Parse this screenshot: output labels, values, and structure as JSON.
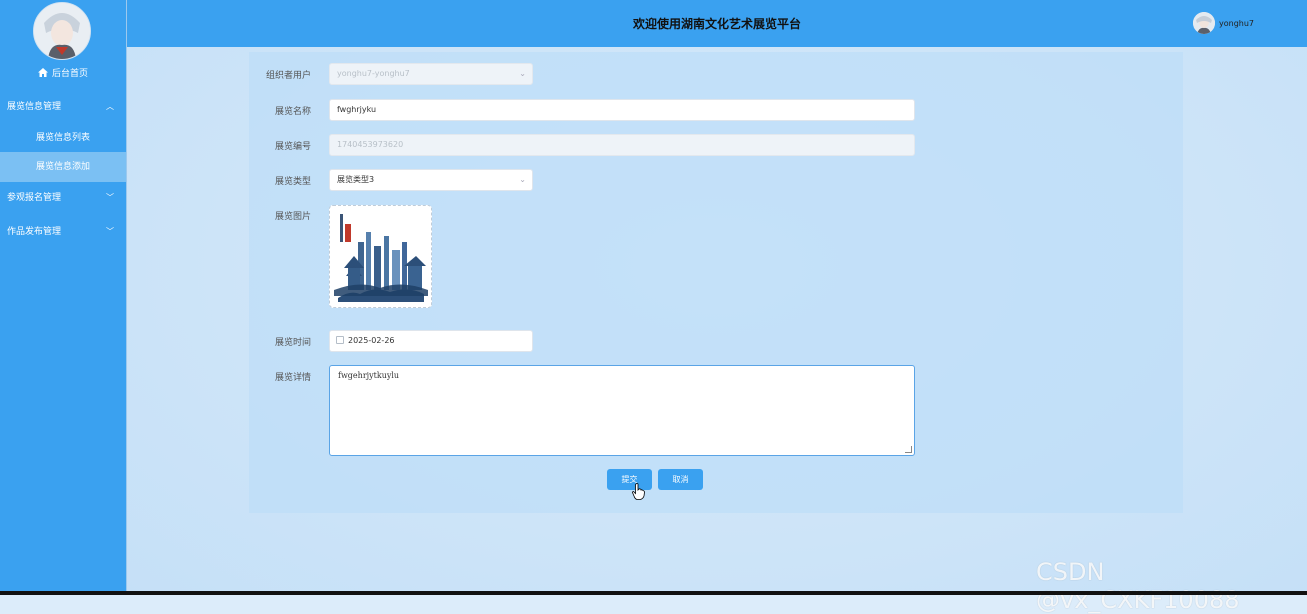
{
  "colors": {
    "primary": "#3aa1f0",
    "active_sub": "#7bc0f3",
    "text": "#111111"
  },
  "sidebar": {
    "home_label": "后台首页",
    "groups": [
      {
        "label": "展览信息管理",
        "expanded": true
      },
      {
        "label": "参观报名管理",
        "expanded": false
      },
      {
        "label": "作品发布管理",
        "expanded": false
      }
    ],
    "sub_items": [
      {
        "label": "展览信息列表",
        "active": false
      },
      {
        "label": "展览信息添加",
        "active": true
      }
    ]
  },
  "header": {
    "title": "欢迎使用湖南文化艺术展览平台",
    "username": "yonghu7"
  },
  "form": {
    "organizer": {
      "label": "组织者用户",
      "value": "yonghu7-yonghu7"
    },
    "name": {
      "label": "展览名称",
      "value": "fwghrjyku"
    },
    "code": {
      "label": "展览编号",
      "value": "1740453973620"
    },
    "type": {
      "label": "展览类型",
      "value": "展览类型3"
    },
    "image": {
      "label": "展览图片"
    },
    "date": {
      "label": "展览时间",
      "value": "2025-02-26"
    },
    "detail": {
      "label": "展览详情",
      "value": "fwgehrjytkuylu"
    }
  },
  "buttons": {
    "submit": "提交",
    "cancel": "取消"
  },
  "watermark": "CSDN @vx_CXKF10088",
  "icons": [
    "home-icon",
    "chevron-up-icon",
    "chevron-down-icon",
    "calendar-icon",
    "hand-cursor-icon"
  ]
}
